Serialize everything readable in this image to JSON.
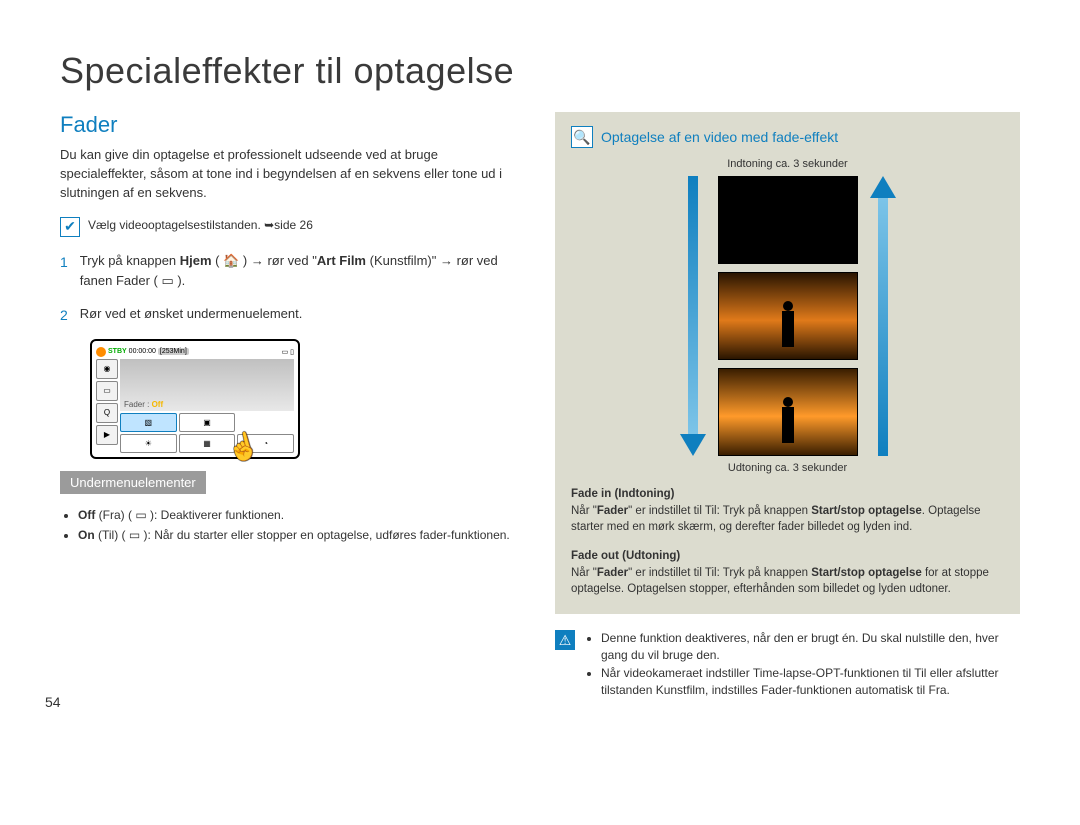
{
  "page_title": "Specialeffekter til optagelse",
  "section_title": "Fader",
  "intro": "Du kan give din optagelse et professionelt udseende ved at bruge specialeffekter, såsom at tone ind i begyndelsen af en sekvens eller tone ud i slutningen af en sekvens.",
  "check_note": "Vælg videooptagelsestilstanden. ➥side 26",
  "step1_pre": "Tryk på knappen ",
  "step1_hjem": "Hjem",
  "step1_mid": " ( 🏠 ) → rør ved \"",
  "step1_artfilm": "Art Film",
  "step1_artfilm_paren": " (Kunstfilm)\" → rør ved fanen Fader ( ▭ ).",
  "step2": "Rør ved et ønsket undermenuelement.",
  "lcd": {
    "stby": "STBY",
    "time": "00:00:00",
    "min": "[253Min]",
    "fader_label_a": "Fader :",
    "fader_label_b": "Off"
  },
  "subheader": "Undermenuelementer",
  "subitems": {
    "off_b": "Off",
    "off_rest": " (Fra) ( ▭ ): Deaktiverer funktionen.",
    "on_b": "On",
    "on_rest": " (Til) ( ▭ ): Når du starter eller stopper en optagelse, udføres fader-funktionen."
  },
  "panel": {
    "title": "Optagelse af en video med fade-effekt",
    "caption_in": "Indtoning ca. 3 sekunder",
    "caption_out": "Udtoning ca. 3 sekunder",
    "fadein_head": "Fade in (Indtoning)",
    "fadein_body_a": "Når \"",
    "fadein_body_b": "Fader",
    "fadein_body_c": "\" er indstillet til Til: Tryk på knappen ",
    "fadein_body_d": "Start/stop optagelse",
    "fadein_body_e": ". Optagelse starter med en mørk skærm, og derefter fader billedet og lyden ind.",
    "fadeout_head": "Fade out (Udtoning)",
    "fadeout_body_a": "Når \"",
    "fadeout_body_b": "Fader",
    "fadeout_body_c": "\" er indstillet til Til: Tryk på knappen ",
    "fadeout_body_d": "Start/stop optagelse",
    "fadeout_body_e": " for at stoppe optagelse. Optagelsen stopper, efterhånden som billedet og lyden udtoner."
  },
  "warnings": {
    "w1": "Denne funktion deaktiveres, når den er brugt én. Du skal nulstille den, hver gang du vil bruge den.",
    "w2": "Når videokameraet indstiller Time-lapse-OPT-funktionen til Til eller afslutter tilstanden Kunstfilm, indstilles Fader-funktionen automatisk til Fra."
  },
  "page_number": "54"
}
